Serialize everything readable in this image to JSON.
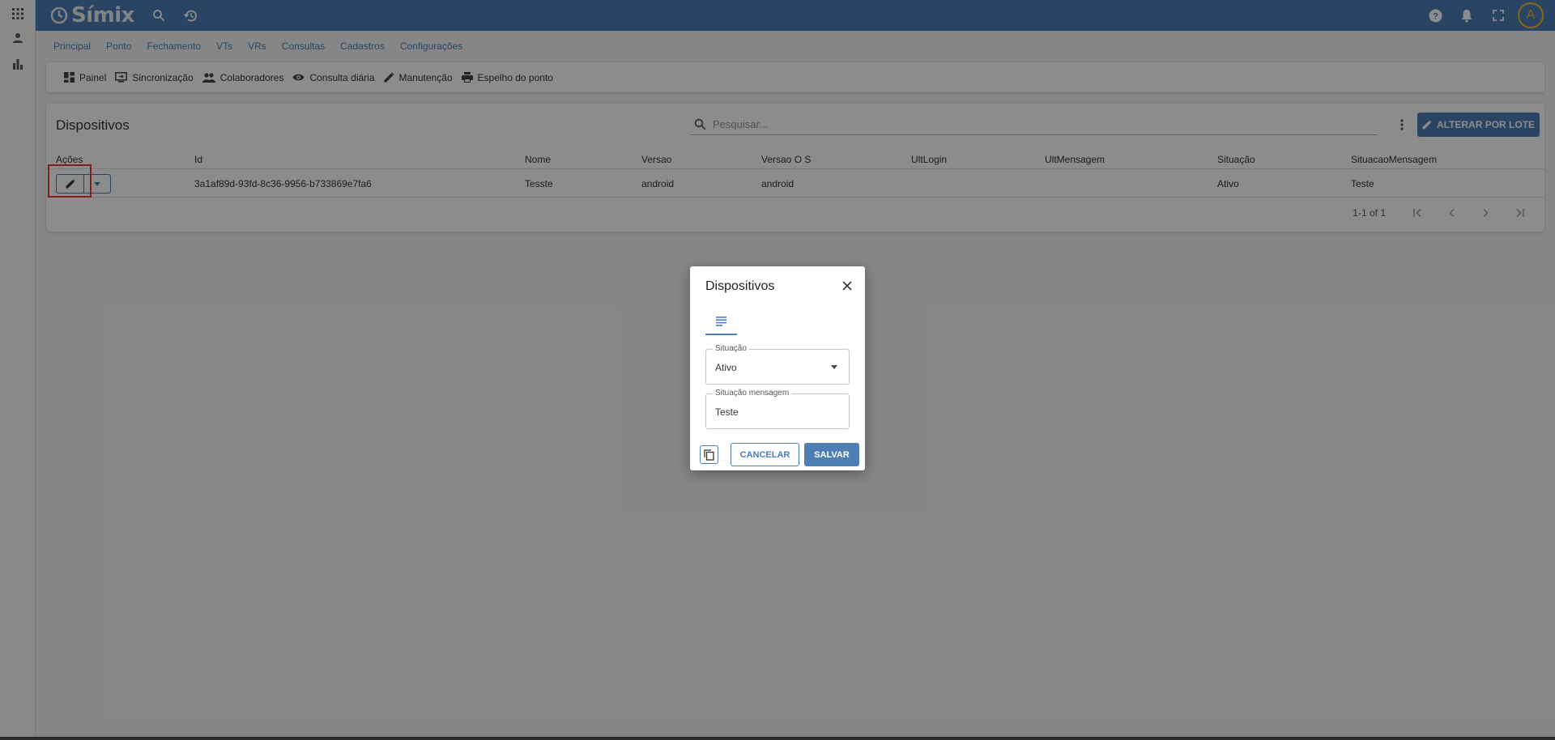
{
  "app": {
    "logo_text": "Símix",
    "avatar_letter": "A"
  },
  "colors": {
    "primary": "#4d7eb4",
    "highlight": "#e53935",
    "avatar_ring": "#f0c030"
  },
  "rail": {
    "icons": [
      "apps-grid-icon",
      "person-icon",
      "bar-chart-icon"
    ]
  },
  "topbar": {
    "icons": [
      "search-icon",
      "history-icon",
      "help-icon",
      "bell-icon",
      "fullscreen-icon"
    ]
  },
  "nav": {
    "items": [
      "Principal",
      "Ponto",
      "Fechamento",
      "VTs",
      "VRs",
      "Consultas",
      "Cadastros",
      "Configurações"
    ]
  },
  "toolbar": {
    "items": [
      {
        "label": "Painel",
        "icon": "dashboard-icon"
      },
      {
        "label": "Sincronização",
        "icon": "sync-monitor-icon"
      },
      {
        "label": "Colaboradores",
        "icon": "people-icon"
      },
      {
        "label": "Consulta diária",
        "icon": "eye-icon"
      },
      {
        "label": "Manutenção",
        "icon": "pencil-icon"
      },
      {
        "label": "Espelho do ponto",
        "icon": "printer-icon"
      }
    ]
  },
  "card": {
    "title": "Dispositivos",
    "search_placeholder": "Pesquisar...",
    "lote_button": "ALTERAR POR LOTE"
  },
  "table": {
    "headers": [
      "Ações",
      "Id",
      "Nome",
      "Versao",
      "Versao O S",
      "UltLogin",
      "UltMensagem",
      "Situação",
      "SituacaoMensagem"
    ],
    "rows": [
      {
        "id": "3a1af89d-93fd-8c36-9956-b733869e7fa6",
        "nome": "Tesste",
        "versao": "android",
        "versao_os": "android",
        "ult_login": "",
        "ult_mensagem": "",
        "situacao": "Ativo",
        "situacao_mensagem": "Teste"
      }
    ],
    "pagination": "1-1 of 1"
  },
  "dialog": {
    "title": "Dispositivos",
    "situacao_label": "Situação",
    "situacao_value": "Ativo",
    "mensagem_label": "Situação mensagem",
    "mensagem_value": "Teste",
    "cancel_label": "CANCELAR",
    "save_label": "SALVAR"
  }
}
